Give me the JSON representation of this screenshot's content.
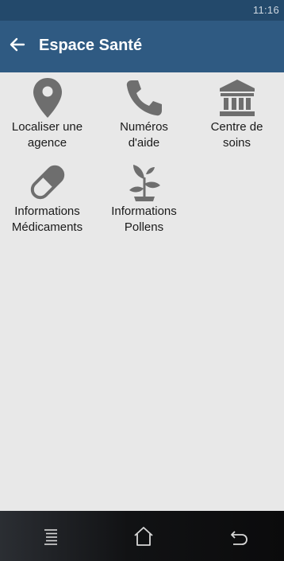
{
  "status_bar": {
    "time": "11:16"
  },
  "app_bar": {
    "title": "Espace Santé",
    "back_icon": "arrow-left-icon"
  },
  "tiles": [
    {
      "label": "Localiser une\nagence",
      "icon": "map-pin-icon"
    },
    {
      "label": "Numéros\nd'aide",
      "icon": "phone-icon"
    },
    {
      "label": "Centre de\nsoins",
      "icon": "bank-building-icon"
    },
    {
      "label": "Informations\nMédicaments",
      "icon": "pill-icon"
    },
    {
      "label": "Informations\nPollens",
      "icon": "plant-sprout-icon"
    }
  ],
  "nav_bar": {
    "items": [
      "menu-icon",
      "home-icon",
      "back-icon"
    ]
  },
  "colors": {
    "status_bar": "#23496b",
    "app_bar": "#2f5a82",
    "background": "#e8e8e8",
    "icon": "#6e6e6e"
  }
}
